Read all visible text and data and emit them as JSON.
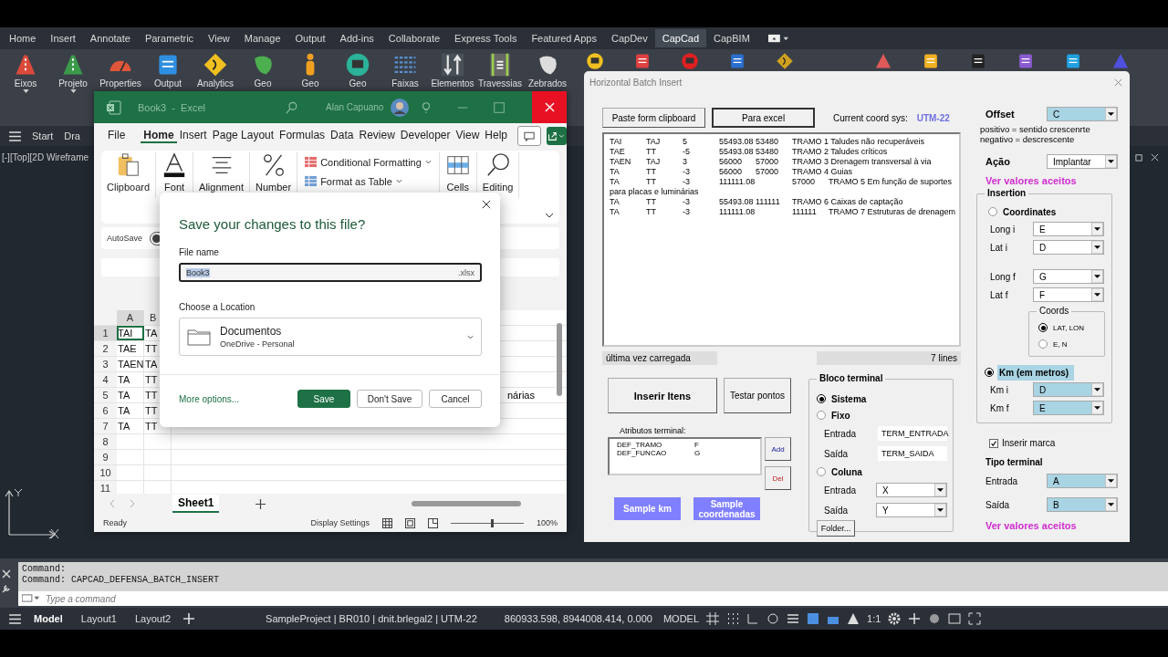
{
  "autocad": {
    "ribbon_tabs": [
      {
        "label": "Home",
        "selected": false
      },
      {
        "label": "Insert",
        "selected": false
      },
      {
        "label": "Annotate",
        "selected": false
      },
      {
        "label": "Parametric",
        "selected": false
      },
      {
        "label": "View",
        "selected": false
      },
      {
        "label": "Manage",
        "selected": false
      },
      {
        "label": "Output",
        "selected": false
      },
      {
        "label": "Add-ins",
        "selected": false
      },
      {
        "label": "Collaborate",
        "selected": false
      },
      {
        "label": "Express Tools",
        "selected": false
      },
      {
        "label": "Featured Apps",
        "selected": false
      },
      {
        "label": "CapDev",
        "selected": false
      },
      {
        "label": "CapCad",
        "selected": true
      },
      {
        "label": "CapBIM",
        "selected": false
      }
    ],
    "ribbon_tools": [
      {
        "label": "Eixos",
        "menu": true
      },
      {
        "label": "Projeto",
        "menu": true
      },
      {
        "label": "Properties",
        "menu": false
      },
      {
        "label": "Output",
        "menu": false
      },
      {
        "label": "Analytics",
        "menu": false
      },
      {
        "label": "Geo",
        "menu": false
      },
      {
        "label": "Geo",
        "menu": false
      },
      {
        "label": "Geo",
        "menu": false
      },
      {
        "label": "Faixas",
        "menu": false
      },
      {
        "label": "Elementos",
        "menu": false
      },
      {
        "label": "Travessias",
        "menu": false
      },
      {
        "label": "Zebrados",
        "menu": false
      }
    ],
    "file_tabs": [
      "Start",
      "Dra"
    ],
    "viewport_label": "[-][Top][2D Wireframe",
    "command_history": [
      "Command:",
      "Command: CAPCAD_DEFENSA_BATCH_INSERT"
    ],
    "command_placeholder": "Type a command",
    "layout_tabs": [
      {
        "label": "Model",
        "selected": true
      },
      {
        "label": "Layout1",
        "selected": false
      },
      {
        "label": "Layout2",
        "selected": false
      }
    ],
    "status_texts": [
      "SampleProject | BR010 | dnit.brlegal2 | UTM-22",
      "860933.598, 8944008.414, 0.000",
      "MODEL"
    ],
    "scale": "1:1"
  },
  "excel": {
    "title": "Book3  -  Excel",
    "user": "Alan Capuano",
    "menu_tabs": [
      {
        "label": "File",
        "selected": false
      },
      {
        "label": "Home",
        "selected": true
      },
      {
        "label": "Insert",
        "selected": false
      },
      {
        "label": "Page Layout",
        "selected": false
      },
      {
        "label": "Formulas",
        "selected": false
      },
      {
        "label": "Data",
        "selected": false
      },
      {
        "label": "Review",
        "selected": false
      },
      {
        "label": "Developer",
        "selected": false
      },
      {
        "label": "View",
        "selected": false
      },
      {
        "label": "Help",
        "selected": false
      }
    ],
    "ribbon_groups": [
      "Clipboard",
      "Font",
      "Alignment",
      "Number"
    ],
    "styles_commands": [
      "Conditional Formatting",
      "Format as Table"
    ],
    "ribbon_groups_right": [
      "Cells",
      "Editing"
    ],
    "autosave": {
      "label": "AutoSave",
      "on": false
    },
    "columns": [
      "A",
      "B"
    ],
    "rows": [
      {
        "number": "1",
        "selected": true,
        "cells": [
          "TAI",
          "TA"
        ]
      },
      {
        "number": "2",
        "selected": false,
        "cells": [
          "TAE",
          "TT"
        ]
      },
      {
        "number": "3",
        "selected": false,
        "cells": [
          "TAEN",
          "TA"
        ]
      },
      {
        "number": "4",
        "selected": false,
        "cells": [
          "TA",
          "TT"
        ]
      },
      {
        "number": "5",
        "selected": false,
        "cells": [
          "TA",
          "TT"
        ],
        "far_text": "nárias"
      },
      {
        "number": "6",
        "selected": false,
        "cells": [
          "TA",
          "TT"
        ]
      },
      {
        "number": "7",
        "selected": false,
        "cells": [
          "TA",
          "TT"
        ]
      },
      {
        "number": "8",
        "selected": false
      },
      {
        "number": "9",
        "selected": false
      },
      {
        "number": "10",
        "selected": false
      },
      {
        "number": "11",
        "selected": false
      }
    ],
    "sheet_tabs": [
      {
        "label": "Sheet1",
        "selected": true
      }
    ],
    "status": "Ready",
    "display_settings": "Display Settings",
    "zoom_slider": {
      "level": 0.55
    },
    "zoom": "100%",
    "save_dialog": {
      "title": "Save your changes to this file?",
      "file_name_label": "File name",
      "file_name": "Book3",
      "extension": ".xlsx",
      "location_label": "Choose a Location",
      "location": "Documentos",
      "location_detail": "OneDrive - Personal",
      "more_options": "More options...",
      "buttons": [
        "Save",
        "Don't Save",
        "Cancel"
      ]
    }
  },
  "batch_dialog": {
    "title": "Horizontal Batch Insert",
    "paste_button": "Paste form clipboard",
    "excel_button": "Para excel",
    "coord_label": "Current coord sys:",
    "coord_value": "UTM-22",
    "lines": [
      "TAI\tTAJ\t5\t55493.08\t53480\tTRAMO 1 Taludes não recuperáveis",
      "TAE\tTT\t-5\t55493.08\t53480\tTRAMO 2 Taludes críticos",
      "TAEN\tTAJ\t3\t56000\t57000\tTRAMO 3 Drenagem transversal à via",
      "TA\tTT\t-3\t56000\t57000\tTRAMO 4 Guias",
      "TA\tTT\t-3\t111111.08\t57000\tTRAMO 5 Em função de suportes",
      "para placas e luminárias",
      "TA\tTT\t-3\t55493.08\t111111\tTRAMO 6 Caixas de captação",
      "TA\tTT\t-3\t111111.08\t111111\tTRAMO 7 Estruturas de drenagem"
    ],
    "loaded_status": "última vez carregada",
    "line_count": "7 lines",
    "insert_button": "Inserir Itens",
    "test_button": "Testar pontos",
    "attributes_label": "Atributos terminal:",
    "attributes": [
      {
        "name": "DEF_TRAMO",
        "column": "F"
      },
      {
        "name": "DEF_FUNCAO",
        "column": "G"
      }
    ],
    "add_button": "Add",
    "del_button": "Del",
    "sample_buttons": [
      "Sample km",
      "Sample coordenadas"
    ],
    "terminal_block": {
      "title": "Bloco terminal",
      "options": [
        {
          "label": "Sistema",
          "selected": true
        },
        {
          "label": "Fixo",
          "selected": false
        },
        {
          "label": "Coluna",
          "selected": false
        }
      ],
      "fixed_fields": [
        {
          "label": "Entrada",
          "value": "TERM_ENTRADA"
        },
        {
          "label": "Saída",
          "value": "TERM_SAIDA"
        }
      ],
      "column_fields": [
        {
          "label": "Entrada",
          "value": "X",
          "highlighted": false
        },
        {
          "label": "Saída",
          "value": "Y",
          "highlighted": false
        }
      ],
      "folder_button": "Folder..."
    },
    "offset": {
      "label": "Offset",
      "value": "C",
      "highlighted": true
    },
    "offset_notes": [
      "positivo = sentido crescenrte",
      "negativo = descrescente"
    ],
    "action": {
      "label": "Ação",
      "value": "Implantar",
      "highlighted": false
    },
    "accepted_link": "Ver valores aceitos",
    "insertion": {
      "title": "Insertion",
      "modes": [
        {
          "label": "Coordinates",
          "selected": false
        },
        {
          "label": "Km (em metros)",
          "selected": true
        }
      ],
      "coordinate_fields": [
        {
          "label": "Long i",
          "value": "E",
          "highlighted": false
        },
        {
          "label": "Lat i",
          "value": "D",
          "highlighted": false
        },
        {
          "label": "Long f",
          "value": "G",
          "highlighted": false
        },
        {
          "label": "Lat f",
          "value": "F",
          "highlighted": false
        }
      ],
      "coords": {
        "title": "Coords",
        "options": [
          {
            "label": "LAT, LON",
            "selected": true
          },
          {
            "label": "E, N",
            "selected": false
          }
        ]
      },
      "km_fields": [
        {
          "label": "Km i",
          "value": "D",
          "highlighted": true
        },
        {
          "label": "Km f",
          "value": "E",
          "highlighted": true
        }
      ]
    },
    "mark_checkbox": {
      "label": "Inserir marca",
      "checked": true
    },
    "terminal_type": {
      "title": "Tipo terminal",
      "fields": [
        {
          "label": "Entrada",
          "value": "A",
          "highlighted": true
        },
        {
          "label": "Saída",
          "value": "B",
          "highlighted": true
        }
      ]
    },
    "accepted_link_bottom": "Ver valores aceitos"
  }
}
